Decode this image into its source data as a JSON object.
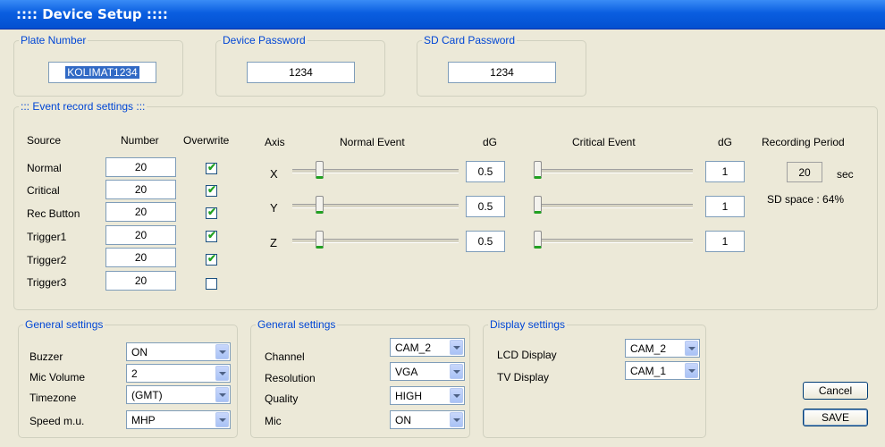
{
  "window": {
    "title": ":::: Device Setup ::::"
  },
  "plate": {
    "legend": "Plate Number",
    "value": "KOLIMAT1234"
  },
  "device_password": {
    "legend": "Device Password",
    "value": "1234"
  },
  "sd_password": {
    "legend": "SD Card Password",
    "value": "1234"
  },
  "event": {
    "legend": "::: Event record settings :::",
    "headers": {
      "source": "Source",
      "number": "Number",
      "overwrite": "Overwrite",
      "axis": "Axis",
      "normal_event": "Normal Event",
      "dg": "dG",
      "critical_event": "Critical Event",
      "dg2": "dG",
      "recording_period": "Recording Period"
    },
    "sources": [
      {
        "label": "Normal",
        "number": "20",
        "overwrite": true
      },
      {
        "label": "Critical",
        "number": "20",
        "overwrite": true
      },
      {
        "label": "Rec Button",
        "number": "20",
        "overwrite": true
      },
      {
        "label": "Trigger1",
        "number": "20",
        "overwrite": true
      },
      {
        "label": "Trigger2",
        "number": "20",
        "overwrite": true
      },
      {
        "label": "Trigger3",
        "number": "20",
        "overwrite": false
      }
    ],
    "axes": [
      {
        "label": "X",
        "normal_level": 0.15,
        "normal_dg": "0.5",
        "critical_level": 0.0,
        "critical_dg": "1"
      },
      {
        "label": "Y",
        "normal_level": 0.15,
        "normal_dg": "0.5",
        "critical_level": 0.0,
        "critical_dg": "1"
      },
      {
        "label": "Z",
        "normal_level": 0.15,
        "normal_dg": "0.5",
        "critical_level": 0.0,
        "critical_dg": "1"
      }
    ],
    "recording_period": {
      "value": "20",
      "unit": "sec"
    },
    "sd_space": "SD space : 64%"
  },
  "general1": {
    "legend": "General settings",
    "rows": [
      {
        "label": "Buzzer",
        "value": "ON"
      },
      {
        "label": "Mic Volume",
        "value": "2"
      },
      {
        "label": "Timezone",
        "value": "(GMT)"
      },
      {
        "label": "Speed m.u.",
        "value": "MHP"
      }
    ]
  },
  "general2": {
    "legend": "General settings",
    "rows": [
      {
        "label": "Channel",
        "value": "CAM_2"
      },
      {
        "label": "Resolution",
        "value": "VGA"
      },
      {
        "label": "Quality",
        "value": "HIGH"
      },
      {
        "label": "Mic",
        "value": "ON"
      }
    ]
  },
  "display": {
    "legend": "Display settings",
    "rows": [
      {
        "label": "LCD Display",
        "value": "CAM_2"
      },
      {
        "label": "TV Display",
        "value": "CAM_1"
      }
    ]
  },
  "buttons": {
    "cancel": "Cancel",
    "save": "SAVE"
  },
  "colors": {
    "titlebar": "#0a5ee0",
    "legend": "#0046d5",
    "thumb_accent": "#21a121",
    "check": "#21a121"
  }
}
